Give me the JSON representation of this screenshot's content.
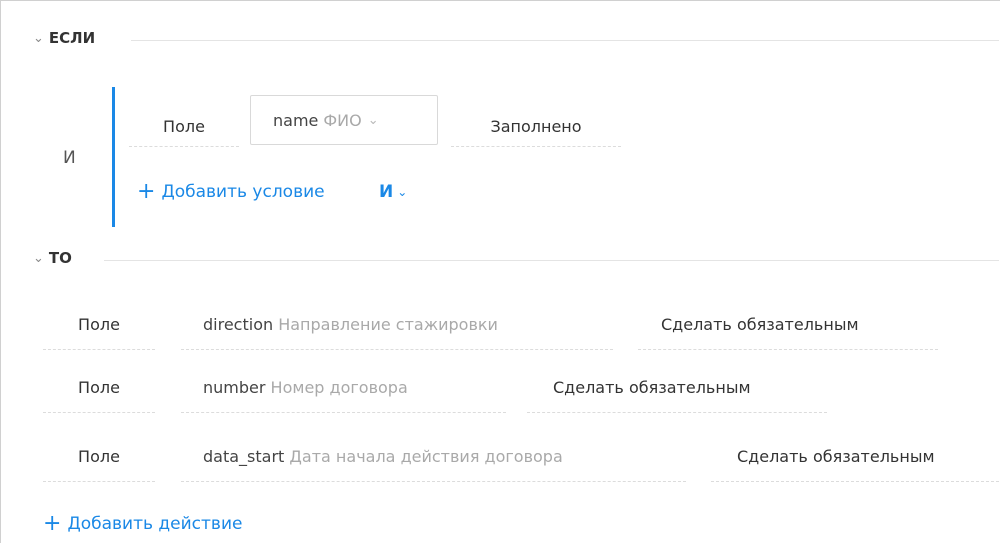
{
  "if_section": {
    "chevron": "⌄",
    "title": "ЕСЛИ",
    "group_operator": "И",
    "condition": {
      "field_label": "Поле",
      "field_key": "name",
      "field_desc": "ФИО",
      "select_chevron": "⌄",
      "value": "Заполнено"
    },
    "add_condition": {
      "plus": "+",
      "label": "Добавить условие",
      "operator": "И",
      "operator_chevron": "⌄"
    }
  },
  "then_section": {
    "chevron": "⌄",
    "title": "ТО",
    "actions": [
      {
        "field_label": "Поле",
        "field_key": "direction",
        "field_desc": "Направление стажировки",
        "action": "Сделать обязательным"
      },
      {
        "field_label": "Поле",
        "field_key": "number",
        "field_desc": "Номер договора",
        "action": "Сделать обязательным"
      },
      {
        "field_label": "Поле",
        "field_key": "data_start",
        "field_desc": "Дата начала действия договора",
        "action": "Сделать обязательным"
      }
    ],
    "add_action": {
      "plus": "+",
      "label": "Добавить действие"
    }
  },
  "colors": {
    "accent": "#1a88e6",
    "muted_text": "#a9a9a9",
    "divider": "#e4e4e4"
  }
}
